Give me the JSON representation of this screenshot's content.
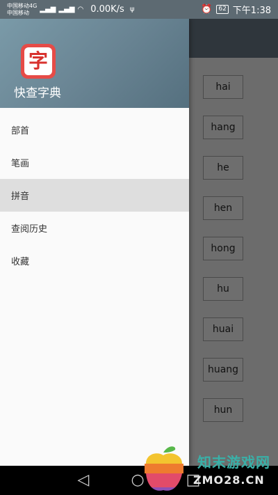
{
  "status_bar": {
    "carrier1": "中国移动4G",
    "carrier2": "中国移动",
    "net1": "4G",
    "speed": "0.00K/s",
    "battery": "62",
    "time": "下午1:38"
  },
  "drawer": {
    "app_name": "快查字典",
    "logo_char": "字",
    "menu": [
      {
        "label": "部首"
      },
      {
        "label": "笔画"
      },
      {
        "label": "拼音"
      },
      {
        "label": "查阅历史"
      },
      {
        "label": "收藏"
      }
    ],
    "active_item": "拼音"
  },
  "pinyin_list": [
    "hai",
    "hang",
    "he",
    "hen",
    "hong",
    "hu",
    "huai",
    "huang",
    "hun"
  ],
  "nav_bar": {
    "back_icon": "◁",
    "home_icon": "○",
    "recent_icon": "□"
  },
  "watermark": {
    "line1": "知末游戏网",
    "line2": "ZMO28.CN"
  },
  "colors": {
    "drawer_header": "#6a8594",
    "active_item_bg": "#dedede",
    "logo_red": "#e64b47"
  }
}
